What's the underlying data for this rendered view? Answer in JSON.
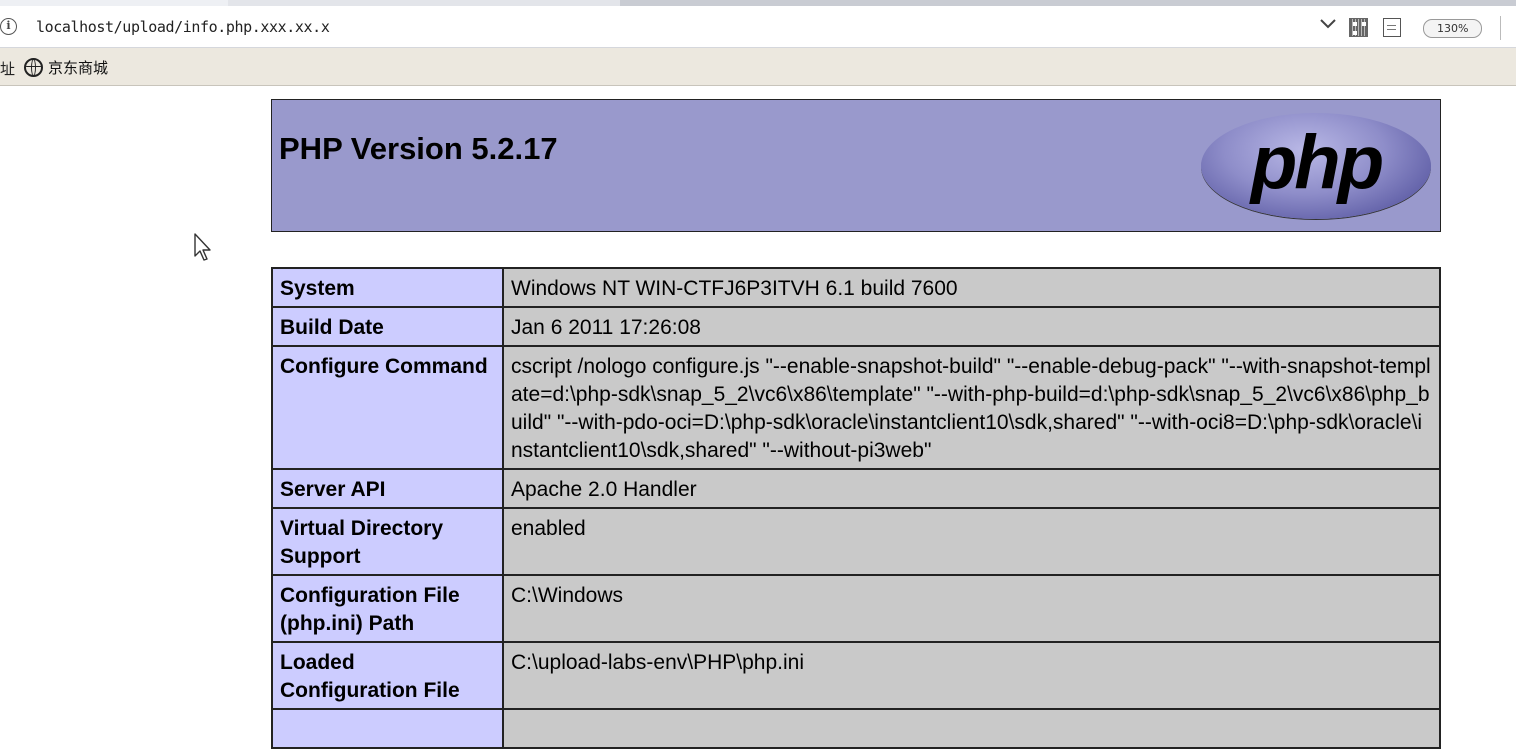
{
  "browser": {
    "address": {
      "url": "localhost/upload/info.php.xxx.xx.x",
      "zoom": "130%"
    },
    "bookmarks": {
      "cut_label": "址",
      "items": [
        {
          "label": "京东商城",
          "icon": "globe-icon"
        }
      ]
    }
  },
  "phpinfo": {
    "title": "PHP Version 5.2.17",
    "logo_text": "php",
    "rows": [
      {
        "key": "System",
        "value": "Windows NT WIN-CTFJ6P3ITVH 6.1 build 7600"
      },
      {
        "key": "Build Date",
        "value": "Jan 6 2011 17:26:08"
      },
      {
        "key": "Configure Command",
        "value": "cscript /nologo configure.js \"--enable-snapshot-build\" \"--enable-debug-pack\" \"--with-snapshot-template=d:\\php-sdk\\snap_5_2\\vc6\\x86\\template\" \"--with-php-build=d:\\php-sdk\\snap_5_2\\vc6\\x86\\php_build\" \"--with-pdo-oci=D:\\php-sdk\\oracle\\instantclient10\\sdk,shared\" \"--with-oci8=D:\\php-sdk\\oracle\\instantclient10\\sdk,shared\" \"--without-pi3web\""
      },
      {
        "key": "Server API",
        "value": "Apache 2.0 Handler"
      },
      {
        "key": "Virtual Directory Support",
        "value": "enabled"
      },
      {
        "key": "Configuration File (php.ini) Path",
        "value": "C:\\Windows"
      },
      {
        "key": "Loaded Configuration File",
        "value": "C:\\upload-labs-env\\PHP\\php.ini"
      },
      {
        "key": "",
        "value": ""
      }
    ]
  },
  "colors": {
    "header_bg": "#9999cc",
    "key_bg": "#ccccff",
    "value_bg": "#c9c9c9"
  }
}
